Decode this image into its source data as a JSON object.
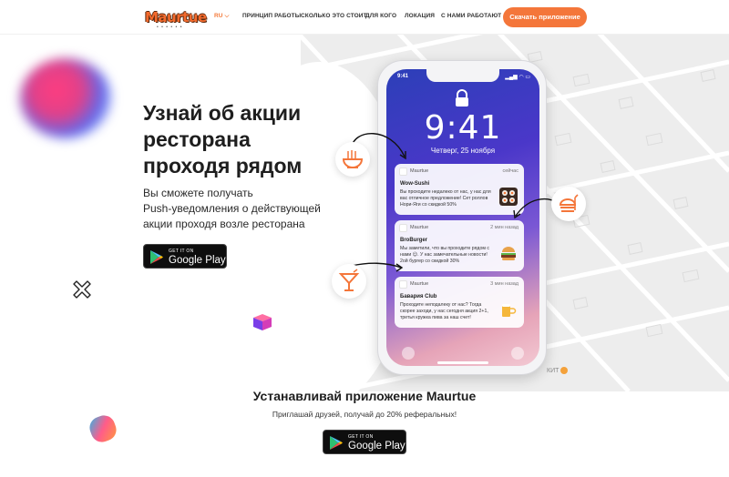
{
  "header": {
    "logo_text": "Maurtue",
    "lang": "RU",
    "nav": [
      "ПРИНЦИП РАБОТЫ",
      "СКОЛЬКО ЭТО СТОИТ",
      "ДЛЯ КОГО",
      "ЛОКАЦИЯ",
      "С НАМИ РАБОТАЮТ"
    ],
    "cta": "Скачать приложение"
  },
  "hero": {
    "title_lines": [
      "Узнай об акции",
      "ресторана",
      "проходя рядом"
    ],
    "subtitle_lines": [
      "Вы сможете получать",
      "Push-уведомления о действующей",
      "акции проходя возле ресторана"
    ],
    "store_small": "GET IT ON",
    "store_big": "Google Play"
  },
  "phone": {
    "status_time": "9:41",
    "clock": "9:41",
    "date": "Четверг, 25 ноября",
    "notifications": [
      {
        "app": "Maurtue",
        "when": "сейчас",
        "title": "Wow-Sushi",
        "body": "Вы проходите недалеко от нас, у нас для вас отличное предложение! Сет роллов Нори-Яги со скидкой 50%"
      },
      {
        "app": "Maurtue",
        "when": "2 мин назад",
        "title": "BroBurger",
        "body": "Мы заметили, что вы проходите рядом с нами 😉. У нас замечательные новости! 2ой бургер со скидкой 30%"
      },
      {
        "app": "Maurtue",
        "when": "3 мин назад",
        "title": "Бавария Club",
        "body": "Проходите неподалеку от нас? Тогда скорее заходи, у нас сегодня акция 2+1, третья кружка пива за наш счет!"
      }
    ]
  },
  "map": {
    "poi_label": "КИТ"
  },
  "install": {
    "title": "Устанавливай приложение Maurtue",
    "subtitle": "Приглашай друзей, получай до 20% реферальных!",
    "store_small": "GET IT ON",
    "store_big": "Google Play"
  },
  "colors": {
    "accent": "#f4763a",
    "text": "#1e1e1e"
  }
}
